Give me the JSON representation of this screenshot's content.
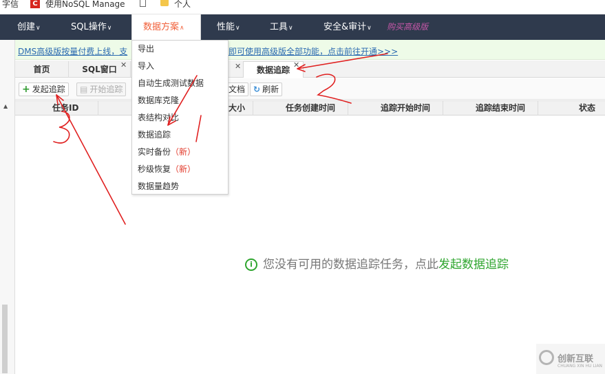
{
  "bookmarks": {
    "item1": "字信",
    "item2": "使用NoSQL Manage",
    "item3": "个人"
  },
  "nav": {
    "items": [
      {
        "label": "创建"
      },
      {
        "label": "SQL操作"
      },
      {
        "label": "数据方案"
      },
      {
        "label": "性能"
      },
      {
        "label": "工具"
      },
      {
        "label": "安全&审计"
      }
    ],
    "buy": "购买高级版"
  },
  "banner": {
    "left": "DMS高级版按量付费上线，支",
    "right": "即可使用高级版全部功能，点击前往开通>>>"
  },
  "tabs": [
    {
      "label": "首页"
    },
    {
      "label": "SQL窗口"
    },
    {
      "label": "数据追踪"
    }
  ],
  "toolbar": {
    "start_track": "发起追踪",
    "begin_track": "开始追踪",
    "doc": "文档",
    "refresh": "刷新"
  },
  "table": {
    "columns": [
      "任务ID",
      "大小",
      "任务创建时间",
      "追踪开始时间",
      "追踪结束时间",
      "状态"
    ]
  },
  "dropdown": {
    "items": [
      {
        "label": "导出"
      },
      {
        "label": "导入"
      },
      {
        "label": "自动生成测试数据"
      },
      {
        "label": "数据库克隆"
      },
      {
        "label": "表结构对比"
      },
      {
        "label": "数据追踪"
      },
      {
        "label": "实时备份",
        "badge": "（新）"
      },
      {
        "label": "秒级恢复",
        "badge": "（新）"
      },
      {
        "label": "数据量趋势"
      }
    ]
  },
  "empty": {
    "text": "您没有可用的数据追踪任务，点此",
    "link": "发起数据追踪"
  },
  "watermark": {
    "text": "创新互联",
    "sub": "CHUANG XIN HU LIAN"
  },
  "annotations": [
    "1",
    "2",
    "3"
  ],
  "colors": {
    "nav_bg": "#2f3a4d",
    "nav_active_text": "#f1603a",
    "accent_green": "#2ea52e",
    "annotation_red": "#e02020",
    "link_blue": "#2b6ab0"
  }
}
